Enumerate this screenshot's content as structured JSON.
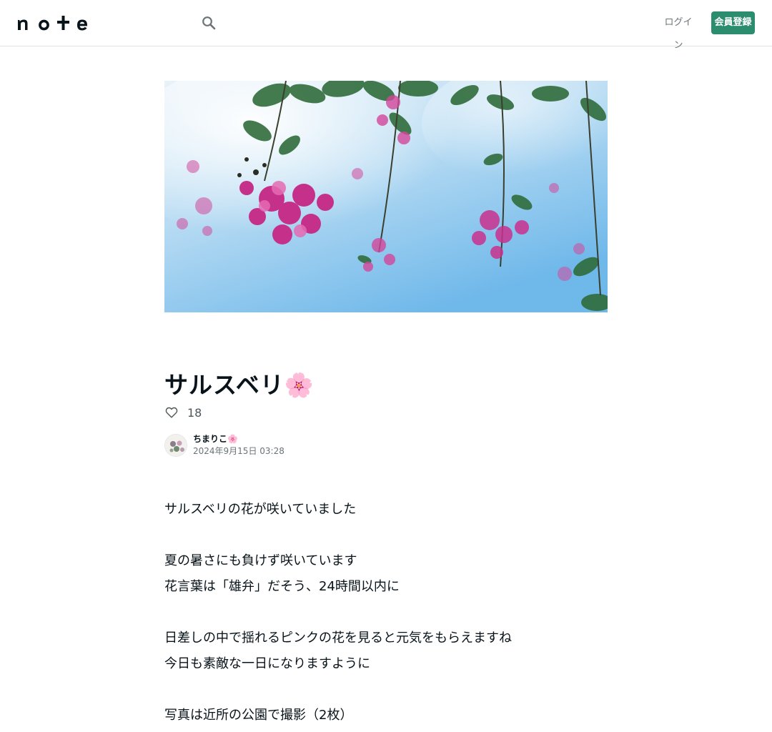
{
  "header": {
    "logo_text": "note",
    "login_label": "ログイン",
    "signup_label": "会員登録",
    "accent_color": "#2b8d6e"
  },
  "article": {
    "title": "サルスベリ🌸",
    "like_count": "18",
    "author_name": "ちまりこ🌸",
    "post_date": "2024年9月15日 03:28",
    "paragraphs": [
      [
        "サルスベリの花が咲いていました"
      ],
      [
        "夏の暑さにも負けず咲いています",
        "花言葉は「雄弁」だそう、24時間以内に"
      ],
      [
        "日差しの中で揺れるピンクの花を見ると元気をもらえますね",
        "今日も素敵な一日になりますように"
      ],
      [
        "写真は近所の公園で撮影（2枚）"
      ]
    ]
  },
  "icons": {
    "search": "search-icon",
    "heart": "heart-icon"
  }
}
